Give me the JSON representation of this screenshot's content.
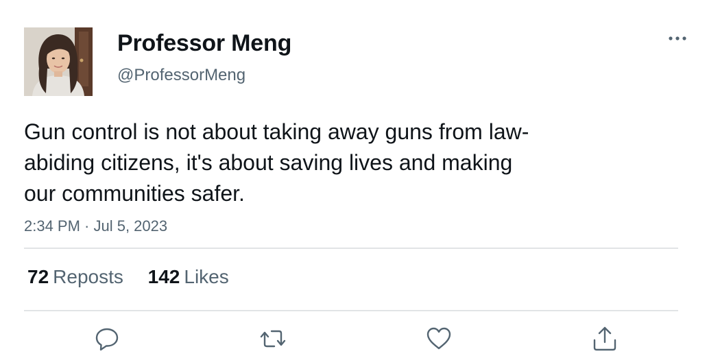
{
  "author": {
    "display_name": "Professor Meng",
    "handle": "@ProfessorMeng"
  },
  "tweet": {
    "text_lines": [
      "Gun control is not about taking away guns from law-",
      "abiding citizens, it's about saving lives and making",
      "our communities safer."
    ],
    "timestamp": "2:34 PM · Jul 5, 2023"
  },
  "stats": {
    "reposts_count": "72",
    "reposts_label": "Reposts",
    "likes_count": "142",
    "likes_label": "Likes"
  },
  "icons": {
    "more": "more-icon",
    "reply": "reply-icon",
    "repost": "repost-icon",
    "like": "like-icon",
    "share": "share-icon"
  },
  "colors": {
    "text": "#0f1419",
    "secondary": "#536471",
    "divider": "#e1e4e6"
  }
}
